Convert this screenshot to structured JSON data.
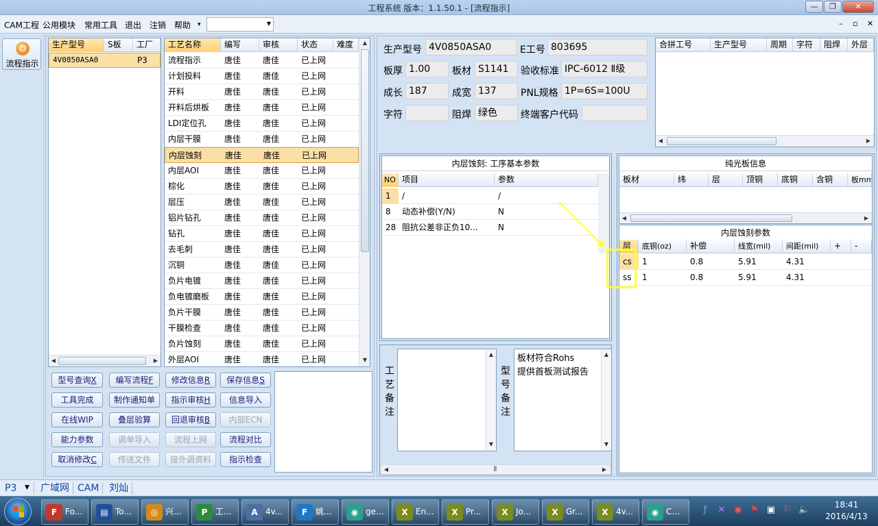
{
  "window": {
    "title": "工程系统   版本：1.1.50.1 - [流程指示]",
    "controls": {
      "min": "—",
      "max": "❐",
      "close": "✕"
    }
  },
  "menu": {
    "items": [
      "CAM工程",
      "公用模块",
      "常用工具",
      "退出",
      "注销",
      "帮助"
    ],
    "help_arrow": "▾",
    "combo_value": "",
    "mdi_controls": {
      "min": "–",
      "restore": "▫",
      "close": "✕"
    }
  },
  "left_strip": {
    "button_label": "流程指示",
    "button_icon": "power-icon"
  },
  "models_list": {
    "headers": [
      "生产型号",
      "S板",
      "工厂"
    ],
    "rows": [
      {
        "model": "4V0850ASA0",
        "s": "",
        "factory": "P3"
      }
    ]
  },
  "process_table": {
    "headers": [
      "工艺名称",
      "编写",
      "审核",
      "状态",
      "难度"
    ],
    "selected_index": 6,
    "rows": [
      [
        "流程指示",
        "唐佳",
        "唐佳",
        "已上网",
        ""
      ],
      [
        "计划投料",
        "唐佳",
        "唐佳",
        "已上网",
        ""
      ],
      [
        "开料",
        "唐佳",
        "唐佳",
        "已上网",
        ""
      ],
      [
        "开料后烘板",
        "唐佳",
        "唐佳",
        "已上网",
        ""
      ],
      [
        "LDI定位孔",
        "唐佳",
        "唐佳",
        "已上网",
        ""
      ],
      [
        "内层干膜",
        "唐佳",
        "唐佳",
        "已上网",
        ""
      ],
      [
        "内层蚀刻",
        "唐佳",
        "唐佳",
        "已上网",
        ""
      ],
      [
        "内层AOI",
        "唐佳",
        "唐佳",
        "已上网",
        ""
      ],
      [
        "棕化",
        "唐佳",
        "唐佳",
        "已上网",
        ""
      ],
      [
        "层压",
        "唐佳",
        "唐佳",
        "已上网",
        ""
      ],
      [
        "铝片钻孔",
        "唐佳",
        "唐佳",
        "已上网",
        ""
      ],
      [
        "钻孔",
        "唐佳",
        "唐佳",
        "已上网",
        ""
      ],
      [
        "去毛刺",
        "唐佳",
        "唐佳",
        "已上网",
        ""
      ],
      [
        "沉铜",
        "唐佳",
        "唐佳",
        "已上网",
        ""
      ],
      [
        "负片电镀",
        "唐佳",
        "唐佳",
        "已上网",
        ""
      ],
      [
        "负电镀磨板",
        "唐佳",
        "唐佳",
        "已上网",
        ""
      ],
      [
        "负片干膜",
        "唐佳",
        "唐佳",
        "已上网",
        ""
      ],
      [
        "干膜检查",
        "唐佳",
        "唐佳",
        "已上网",
        ""
      ],
      [
        "负片蚀刻",
        "唐佳",
        "唐佳",
        "已上网",
        ""
      ],
      [
        "外层AOI",
        "唐佳",
        "唐佳",
        "已上网",
        ""
      ]
    ]
  },
  "action_buttons": [
    [
      {
        "label": "型号查询",
        "key": "X",
        "enabled": true
      },
      {
        "label": "编写流程",
        "key": "F",
        "enabled": true
      },
      {
        "label": "修改信息",
        "key": "R",
        "enabled": true
      },
      {
        "label": "保存信息",
        "key": "S",
        "enabled": true
      }
    ],
    [
      {
        "label": "工具完成",
        "key": "",
        "enabled": true
      },
      {
        "label": "制作通知单",
        "key": "",
        "enabled": true
      },
      {
        "label": "指示审核",
        "key": "H",
        "enabled": true
      },
      {
        "label": "信息导入",
        "key": "",
        "enabled": true
      }
    ],
    [
      {
        "label": "在线WIP",
        "key": "",
        "enabled": true
      },
      {
        "label": "叠层验算",
        "key": "",
        "enabled": true
      },
      {
        "label": "回退审核",
        "key": "B",
        "enabled": true
      },
      {
        "label": "内部ECN",
        "key": "",
        "enabled": false
      }
    ],
    [
      {
        "label": "能力参数",
        "key": "",
        "enabled": true
      },
      {
        "label": "调单导入",
        "key": "",
        "enabled": false
      },
      {
        "label": "流程上网",
        "key": "",
        "enabled": false
      },
      {
        "label": "流程对比",
        "key": "",
        "enabled": true
      }
    ],
    [
      {
        "label": "取消修改",
        "key": "C",
        "enabled": true
      },
      {
        "label": "传送文件",
        "key": "",
        "enabled": false
      },
      {
        "label": "接外调资料",
        "key": "",
        "enabled": false
      },
      {
        "label": "指示检查",
        "key": "",
        "enabled": true
      }
    ]
  ],
  "info": {
    "model_label": "生产型号",
    "model_value": "4V0850ASA0",
    "e_label": "E工号",
    "e_value": "803695",
    "thickness_label": "板厚",
    "thickness_value": "1.00",
    "material_label": "板材",
    "material_value": "S1141",
    "standard_label": "验收标准",
    "standard_value": "IPC-6012 Ⅱ级",
    "length_label": "成长",
    "length_value": "187",
    "width_label": "成宽",
    "width_value": "137",
    "pnl_label": "PNL规格",
    "pnl_value": "1P=6S=100U",
    "char_label": "字符",
    "char_value": "",
    "mask_label": "阻焊",
    "mask_value": "绿色",
    "customer_label": "终端客户代码",
    "customer_value": ""
  },
  "combine_table": {
    "headers": [
      "合拼工号",
      "生产型号",
      "周期",
      "字符",
      "阻焊",
      "外层"
    ]
  },
  "params": {
    "title": "内层蚀刻: 工序基本参数",
    "headers": [
      "NO",
      "项目",
      "参数"
    ],
    "rows": [
      {
        "no": "1",
        "item": "/",
        "value": "/"
      },
      {
        "no": "8",
        "item": "动态补偿(Y/N)",
        "value": "N"
      },
      {
        "no": "28",
        "item": "阻抗公差非正负10...",
        "value": "N"
      }
    ]
  },
  "bare_board": {
    "title": "纯光板信息",
    "headers": [
      "板材",
      "纬",
      "层",
      "顶铜",
      "底铜",
      "含铜",
      "板mm"
    ]
  },
  "etch_params": {
    "title": "内层蚀刻参数",
    "headers": [
      "层",
      "底铜(oz)",
      "补偿",
      "线宽(mil)",
      "间距(mil)",
      "+",
      "-"
    ],
    "rows": [
      {
        "layer": "cs",
        "copper": "1",
        "comp": "0.8",
        "width": "5.91",
        "spacing": "4.31"
      },
      {
        "layer": "ss",
        "copper": "1",
        "comp": "0.8",
        "width": "5.91",
        "spacing": "4.31"
      }
    ]
  },
  "remarks": {
    "process_label": "工艺备注",
    "process_text": "",
    "model_label": "型号备注",
    "model_text_1": "板材符合Rohs",
    "model_text_2": "提供首板测试报告"
  },
  "status_bar": {
    "factory": "P3",
    "network": "广域网",
    "module": "CAM",
    "user": "刘灿"
  },
  "taskbar": {
    "items": [
      {
        "label": "Fo...",
        "color": "#c0392b",
        "glyph": "F"
      },
      {
        "label": "To...",
        "color": "#1f4f9a",
        "glyph": "▤"
      },
      {
        "label": "兴...",
        "color": "#d48a1b",
        "glyph": "◎"
      },
      {
        "label": "工...",
        "color": "#2e8b3e",
        "glyph": "P"
      },
      {
        "label": "4v...",
        "color": "#4a6fa5",
        "glyph": "A"
      },
      {
        "label": "姚...",
        "color": "#1e78c8",
        "glyph": "F"
      },
      {
        "label": "ge...",
        "color": "#2aa090",
        "glyph": "◉"
      },
      {
        "label": "En...",
        "color": "#7a8b1f",
        "glyph": "X"
      },
      {
        "label": "Pr...",
        "color": "#7a8b1f",
        "glyph": "X"
      },
      {
        "label": "Jo...",
        "color": "#7a8b1f",
        "glyph": "X"
      },
      {
        "label": "Gr...",
        "color": "#7a8b1f",
        "glyph": "X"
      },
      {
        "label": "4v...",
        "color": "#7a8b1f",
        "glyph": "X"
      },
      {
        "label": "C...",
        "color": "#2aa090",
        "glyph": "◉"
      }
    ],
    "time": "18:41",
    "date": "2016/4/13"
  },
  "annotation": {
    "color": "#ffff33"
  },
  "colors": {
    "selection": "#fbe0a6",
    "header_selected": "#ffcf6e",
    "link_text": "#0d47a1"
  }
}
